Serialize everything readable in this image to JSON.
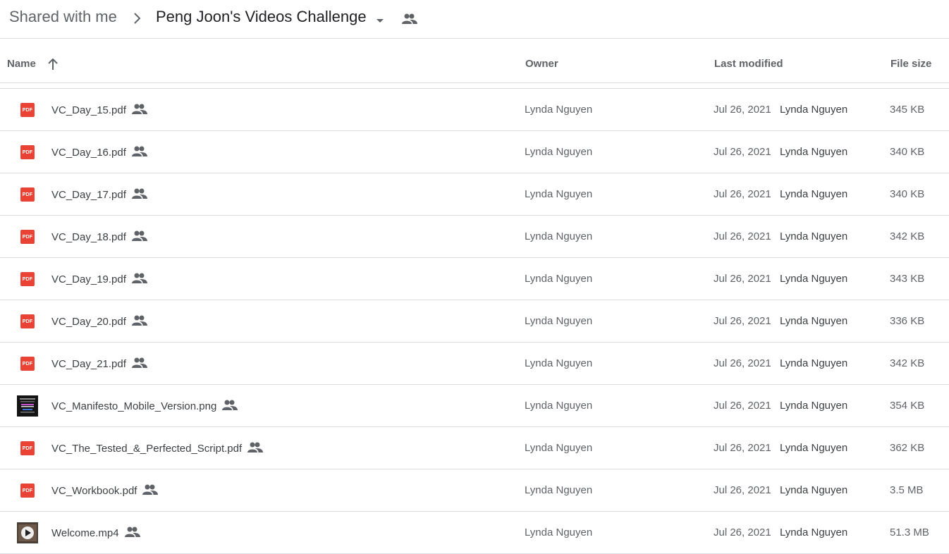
{
  "breadcrumb": {
    "root": "Shared with me",
    "current": "Peng Joon's Videos Challenge"
  },
  "columns": {
    "name": "Name",
    "owner": "Owner",
    "last_modified": "Last modified",
    "file_size": "File size"
  },
  "files": [
    {
      "name": "VC_Day_15.pdf",
      "type": "pdf",
      "owner": "Lynda Nguyen",
      "modified_date": "Jul 26, 2021",
      "modified_by": "Lynda Nguyen",
      "size": "345 KB"
    },
    {
      "name": "VC_Day_16.pdf",
      "type": "pdf",
      "owner": "Lynda Nguyen",
      "modified_date": "Jul 26, 2021",
      "modified_by": "Lynda Nguyen",
      "size": "340 KB"
    },
    {
      "name": "VC_Day_17.pdf",
      "type": "pdf",
      "owner": "Lynda Nguyen",
      "modified_date": "Jul 26, 2021",
      "modified_by": "Lynda Nguyen",
      "size": "340 KB"
    },
    {
      "name": "VC_Day_18.pdf",
      "type": "pdf",
      "owner": "Lynda Nguyen",
      "modified_date": "Jul 26, 2021",
      "modified_by": "Lynda Nguyen",
      "size": "342 KB"
    },
    {
      "name": "VC_Day_19.pdf",
      "type": "pdf",
      "owner": "Lynda Nguyen",
      "modified_date": "Jul 26, 2021",
      "modified_by": "Lynda Nguyen",
      "size": "343 KB"
    },
    {
      "name": "VC_Day_20.pdf",
      "type": "pdf",
      "owner": "Lynda Nguyen",
      "modified_date": "Jul 26, 2021",
      "modified_by": "Lynda Nguyen",
      "size": "336 KB"
    },
    {
      "name": "VC_Day_21.pdf",
      "type": "pdf",
      "owner": "Lynda Nguyen",
      "modified_date": "Jul 26, 2021",
      "modified_by": "Lynda Nguyen",
      "size": "342 KB"
    },
    {
      "name": "VC_Manifesto_Mobile_Version.png",
      "type": "image",
      "owner": "Lynda Nguyen",
      "modified_date": "Jul 26, 2021",
      "modified_by": "Lynda Nguyen",
      "size": "354 KB"
    },
    {
      "name": "VC_The_Tested_&_Perfected_Script.pdf",
      "type": "pdf",
      "owner": "Lynda Nguyen",
      "modified_date": "Jul 26, 2021",
      "modified_by": "Lynda Nguyen",
      "size": "362 KB"
    },
    {
      "name": "VC_Workbook.pdf",
      "type": "pdf",
      "owner": "Lynda Nguyen",
      "modified_date": "Jul 26, 2021",
      "modified_by": "Lynda Nguyen",
      "size": "3.5 MB"
    },
    {
      "name": "Welcome.mp4",
      "type": "video",
      "owner": "Lynda Nguyen",
      "modified_date": "Jul 26, 2021",
      "modified_by": "Lynda Nguyen",
      "size": "51.3 MB"
    }
  ],
  "icons": {
    "pdf_badge_text": "PDF",
    "pdf_color": "#ea4335",
    "shared": "people-icon",
    "sort": "arrow-up-icon"
  }
}
